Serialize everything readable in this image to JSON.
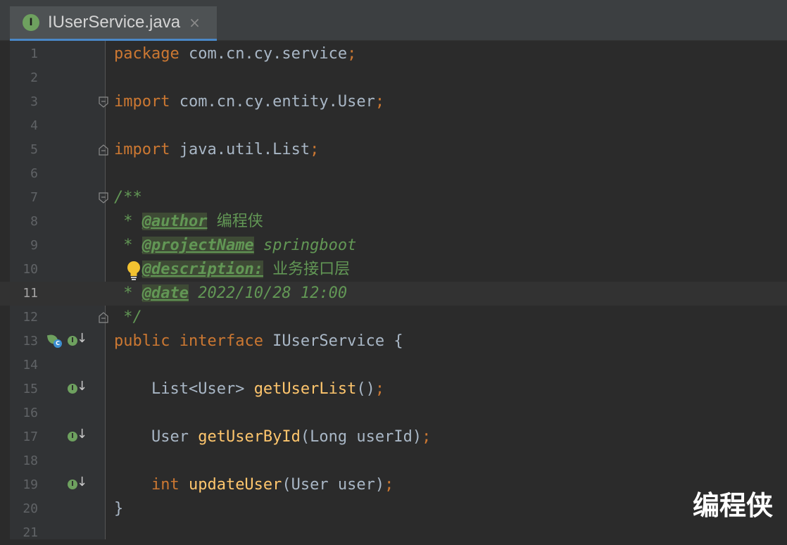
{
  "tab": {
    "icon_letter": "I",
    "title": "IUserService.java",
    "close": "×"
  },
  "lines": [
    {
      "n": "1"
    },
    {
      "n": "2"
    },
    {
      "n": "3"
    },
    {
      "n": "4"
    },
    {
      "n": "5"
    },
    {
      "n": "6"
    },
    {
      "n": "7"
    },
    {
      "n": "8"
    },
    {
      "n": "9"
    },
    {
      "n": "10"
    },
    {
      "n": "11"
    },
    {
      "n": "12"
    },
    {
      "n": "13"
    },
    {
      "n": "14"
    },
    {
      "n": "15"
    },
    {
      "n": "16"
    },
    {
      "n": "17"
    },
    {
      "n": "18"
    },
    {
      "n": "19"
    },
    {
      "n": "20"
    },
    {
      "n": "21"
    }
  ],
  "code": {
    "l1": {
      "kw": "package",
      "pkg": " com.cn.cy.service",
      "semi": ";"
    },
    "l3": {
      "kw": "import",
      "pkg": " com.cn.cy.entity.User",
      "semi": ";"
    },
    "l5": {
      "kw": "import",
      "pkg": " java.util.List",
      "semi": ";"
    },
    "l7": {
      "open": "/**"
    },
    "l8": {
      "star": " * ",
      "tag": "@author",
      "val": " 编程侠"
    },
    "l9": {
      "star": " * ",
      "tag": "@projectName",
      "val": " springboot"
    },
    "l10": {
      "star": "   ",
      "tag": "@description:",
      "val": " 业务接口层"
    },
    "l11": {
      "star": " * ",
      "tag": "@date",
      "val": " 2022/10/28 12:00"
    },
    "l12": {
      "close": " */"
    },
    "l13": {
      "kw1": "public",
      "kw2": " interface",
      "name": " IUserService",
      "brace": " {"
    },
    "l15": {
      "type": "    List<User> ",
      "fn": "getUserList",
      "rest": "()",
      "semi": ";"
    },
    "l17": {
      "type": "    User ",
      "fn": "getUserById",
      "rest": "(Long userId)",
      "semi": ";"
    },
    "l19": {
      "kw": "    int",
      "fn": " updateUser",
      "rest": "(User user)",
      "semi": ";"
    },
    "l20": {
      "brace": "}"
    }
  },
  "current_line": "11",
  "gutter_icons": {
    "impl_letter": "I",
    "impl_arrow": "↓",
    "spring_c": "C"
  },
  "watermark": "编程侠",
  "colors": {
    "keyword": "#cc7832",
    "function": "#ffc66d",
    "doc": "#629755",
    "text": "#a9b7c6",
    "background": "#2b2b2b",
    "gutter": "#313335"
  }
}
